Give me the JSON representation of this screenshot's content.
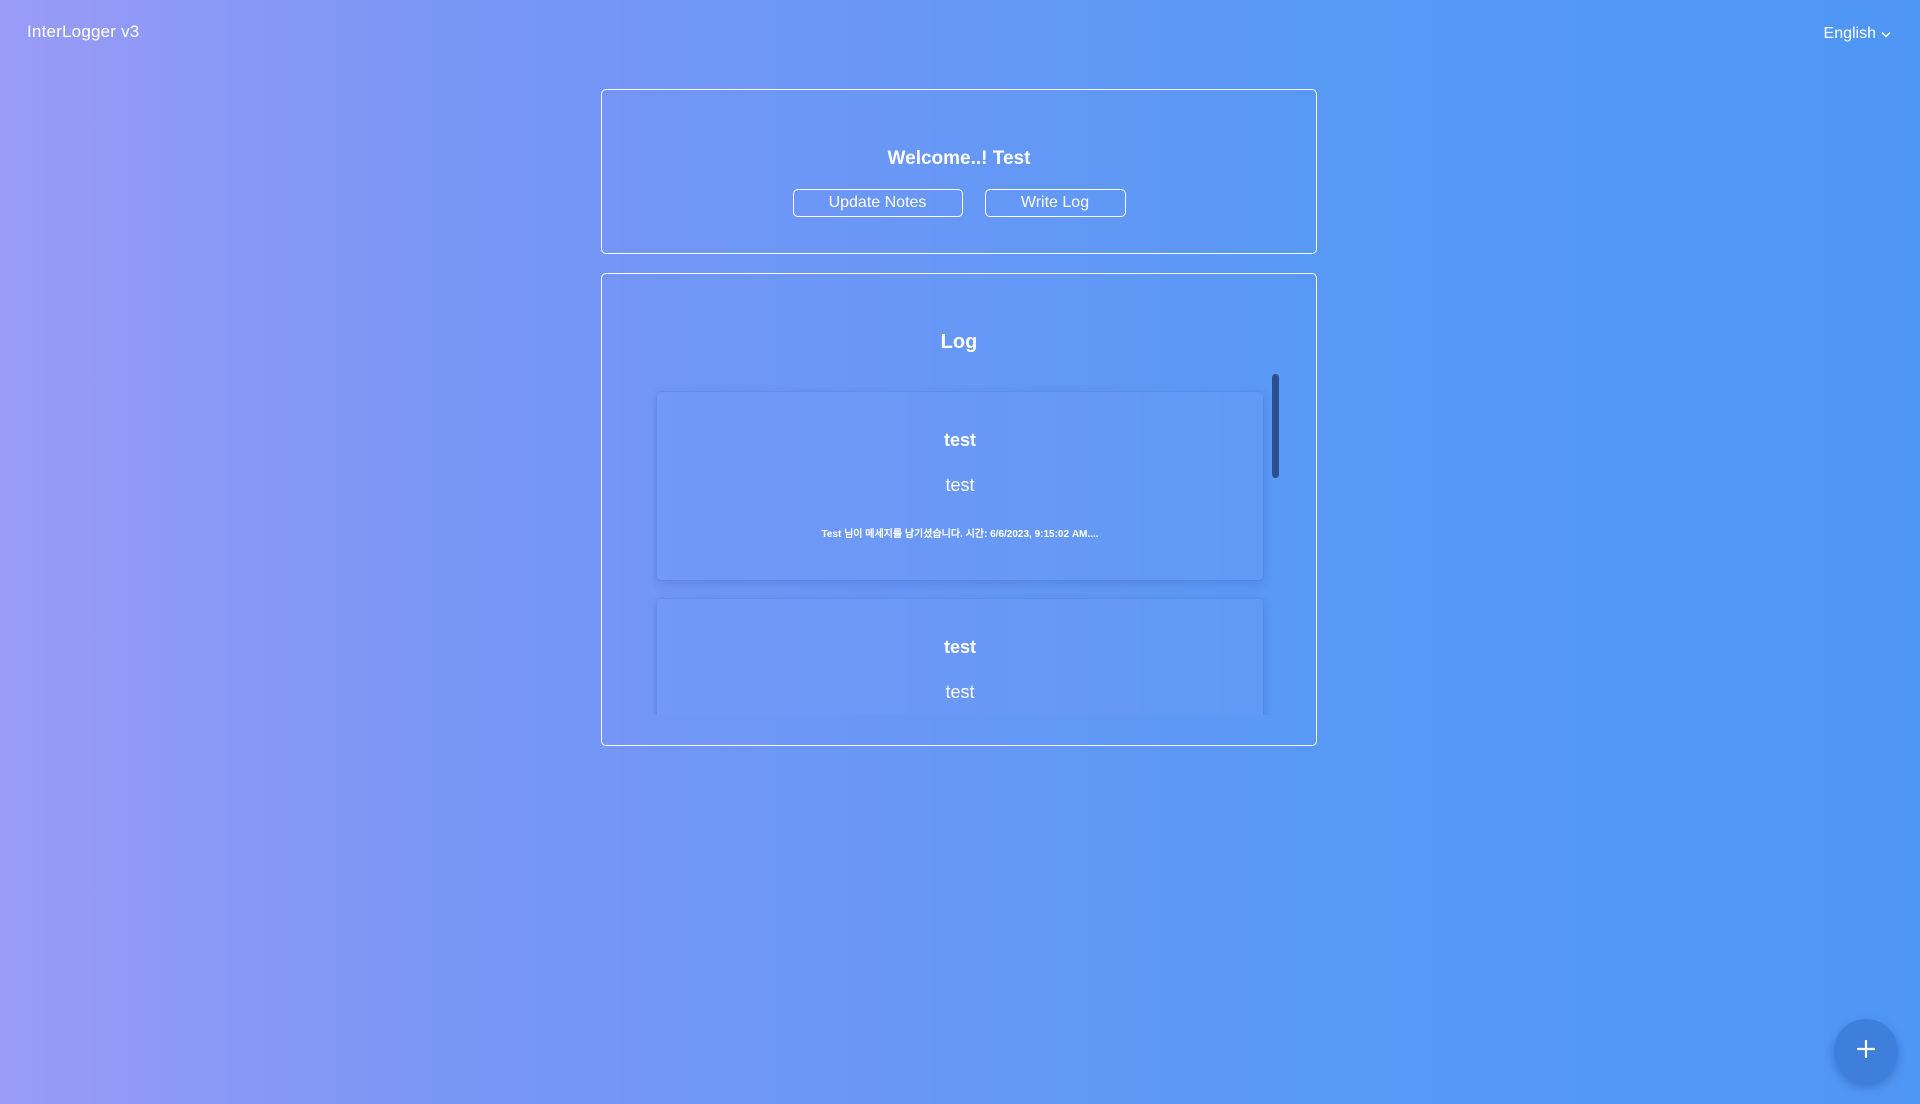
{
  "header": {
    "app_title": "InterLogger v3",
    "language": "English",
    "language_icon": "chevron-down-icon"
  },
  "welcome": {
    "title": "Welcome..! Test",
    "update_notes_label": "Update Notes",
    "write_log_label": "Write Log"
  },
  "log": {
    "title": "Log",
    "items": [
      {
        "title": "test",
        "body": "test",
        "meta": "Test 님이 메세지를 남기셨습니다. 시간: 6/6/2023, 9:15:02 AM...."
      },
      {
        "title": "test",
        "body": "test"
      }
    ]
  },
  "fab": {
    "icon": "plus-icon"
  },
  "colors": {
    "background_start": "#9a9bf7",
    "background_end": "#4f97f5",
    "scrollbar_thumb": "#2e4f8f",
    "fab": "#3f7fdc"
  }
}
